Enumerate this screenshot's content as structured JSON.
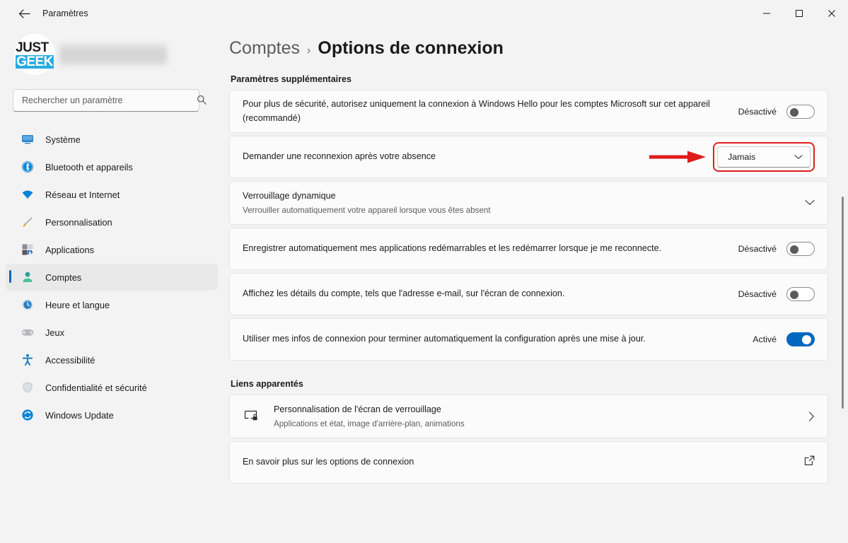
{
  "window": {
    "title": "Paramètres",
    "back_icon": "arrow-left-icon",
    "controls": {
      "minimize": "–",
      "maximize": "▢",
      "close": "✕"
    }
  },
  "sidebar": {
    "logo": {
      "line1": "JUST",
      "line2": "GEEK"
    },
    "account_name_blurred": "",
    "search": {
      "placeholder": "Rechercher un paramètre",
      "value": "",
      "icon": "search-icon"
    },
    "items": [
      {
        "label": "Système",
        "icon": "monitor-icon",
        "selected": false
      },
      {
        "label": "Bluetooth et appareils",
        "icon": "bluetooth-icon",
        "selected": false
      },
      {
        "label": "Réseau et Internet",
        "icon": "wifi-icon",
        "selected": false
      },
      {
        "label": "Personnalisation",
        "icon": "paintbrush-icon",
        "selected": false
      },
      {
        "label": "Applications",
        "icon": "apps-grid-icon",
        "selected": false
      },
      {
        "label": "Comptes",
        "icon": "person-icon",
        "selected": true
      },
      {
        "label": "Heure et langue",
        "icon": "clock-icon",
        "selected": false
      },
      {
        "label": "Jeux",
        "icon": "gamepad-icon",
        "selected": false
      },
      {
        "label": "Accessibilité",
        "icon": "accessibility-icon",
        "selected": false
      },
      {
        "label": "Confidentialité et sécurité",
        "icon": "shield-icon",
        "selected": false
      },
      {
        "label": "Windows Update",
        "icon": "update-refresh-icon",
        "selected": false
      }
    ]
  },
  "main": {
    "breadcrumb": {
      "parent": "Comptes",
      "separator": "›",
      "current": "Options de connexion"
    },
    "sections": {
      "additional_settings_label": "Paramètres supplémentaires",
      "related_links_label": "Liens apparentés"
    },
    "rows": [
      {
        "title": "Pour plus de sécurité, autorisez uniquement la connexion à Windows Hello pour les comptes Microsoft sur cet appareil (recommandé)",
        "control": "toggle",
        "state_label": "Désactivé",
        "state": "off"
      },
      {
        "title": "Demander une reconnexion après votre absence",
        "control": "dropdown",
        "value": "Jamais",
        "highlighted": true,
        "annotation": "red-arrow-icon"
      },
      {
        "title": "Verrouillage dynamique",
        "subtitle": "Verrouiller automatiquement votre appareil lorsque vous êtes absent",
        "control": "expander",
        "icon": "chevron-down-icon"
      },
      {
        "title": "Enregistrer automatiquement mes applications redémarrables et les redémarrer lorsque je me reconnecte.",
        "control": "toggle",
        "state_label": "Désactivé",
        "state": "off"
      },
      {
        "title": "Affichez les détails du compte, tels que l'adresse e-mail, sur l'écran de connexion.",
        "control": "toggle",
        "state_label": "Désactivé",
        "state": "off"
      },
      {
        "title": "Utiliser mes infos de connexion pour terminer automatiquement la configuration après une mise à jour.",
        "control": "toggle",
        "state_label": "Activé",
        "state": "on"
      }
    ],
    "related_links": [
      {
        "title": "Personnalisation de l'écran de verrouillage",
        "subtitle": "Applications et état, image d'arrière-plan, animations",
        "icon": "lock-screen-icon",
        "action_icon": "chevron-right-icon"
      },
      {
        "title": "En savoir plus sur les options de connexion",
        "icon": "",
        "action_icon": "external-link-icon"
      }
    ]
  },
  "colors": {
    "accent": "#0067c0",
    "annotation": "#e02020",
    "window_bg": "#f3f3f3",
    "card_bg": "#fbfbfb",
    "logo_cyan": "#29abe2"
  }
}
